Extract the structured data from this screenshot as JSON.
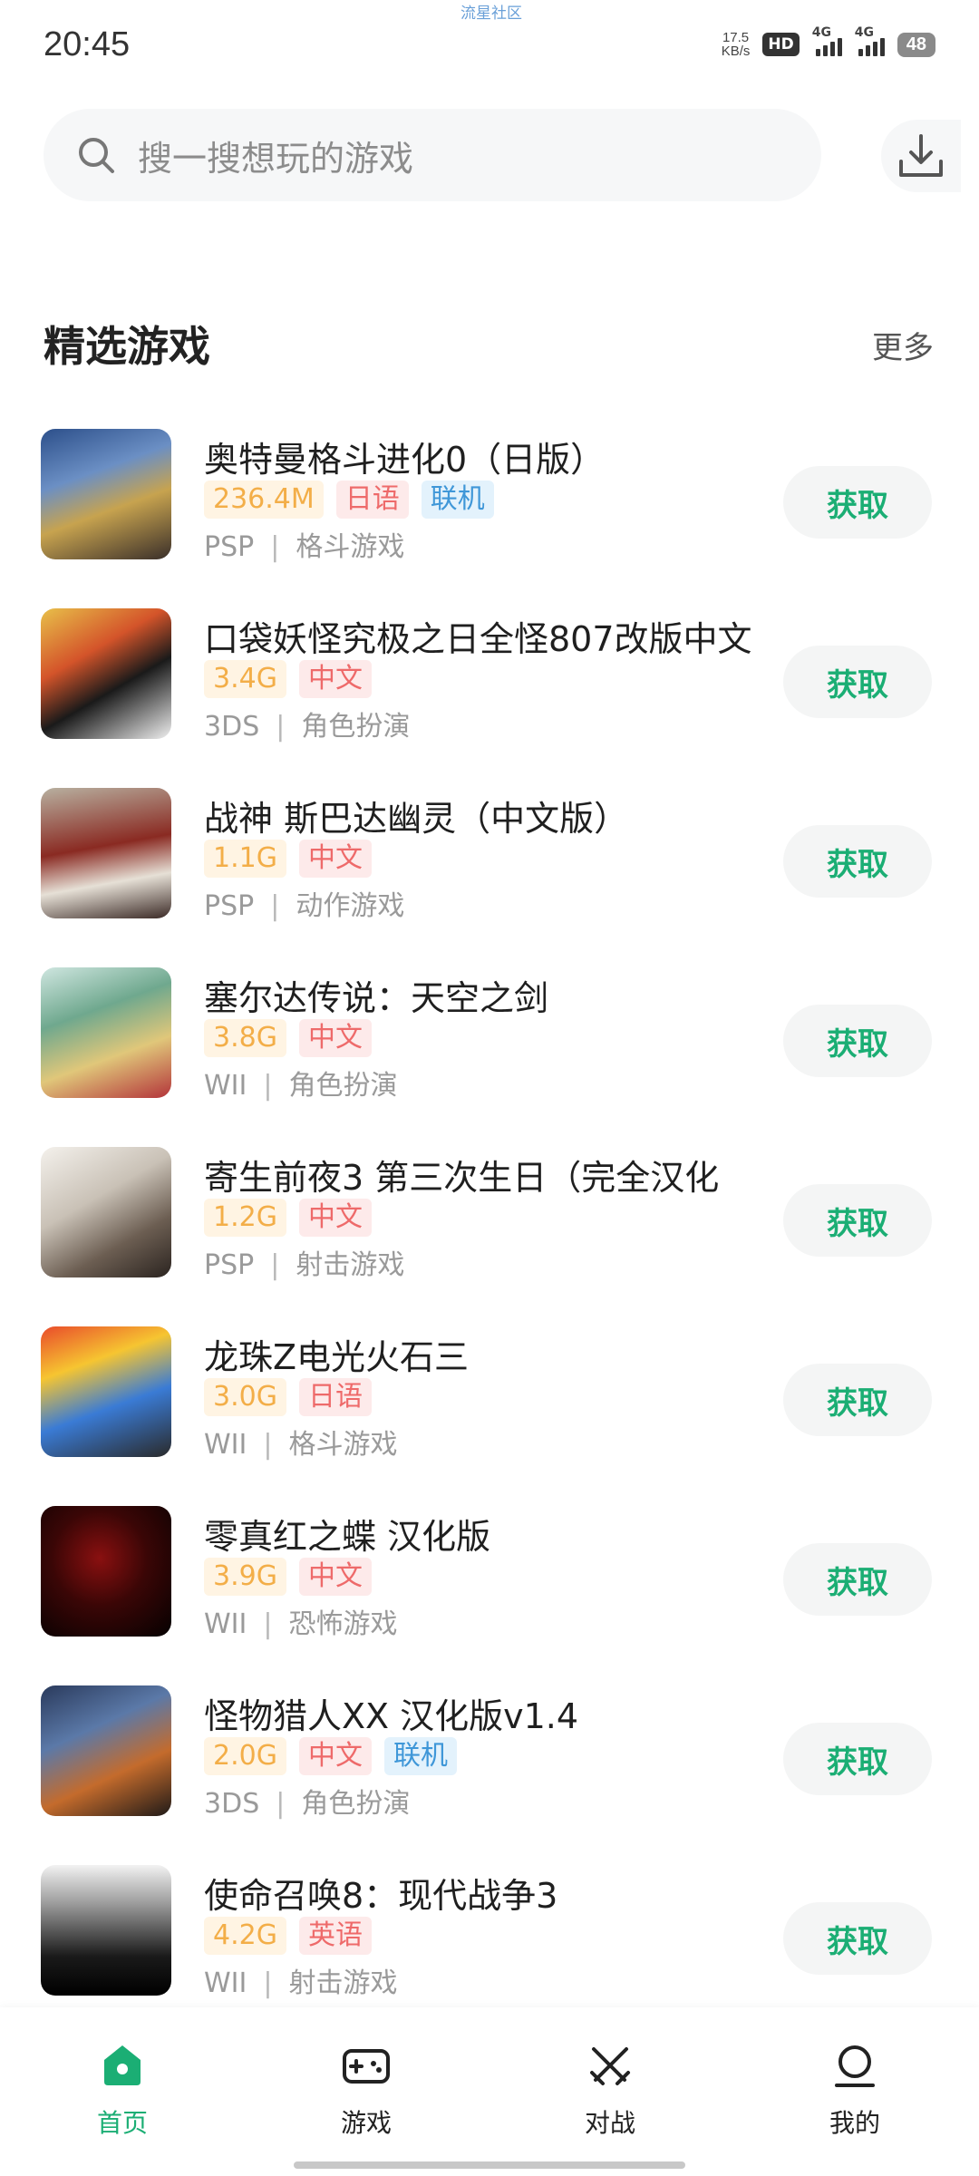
{
  "status_bar": {
    "time": "20:45",
    "center_text": "流星社区",
    "net_speed_value": "17.5",
    "net_speed_unit": "KB/s",
    "hd_label": "HD",
    "signal_label": "4G",
    "battery": "48"
  },
  "search": {
    "placeholder": "搜一搜想玩的游戏"
  },
  "section": {
    "title": "精选游戏",
    "more": "更多"
  },
  "games": [
    {
      "name": "奥特曼格斗进化0（日版）",
      "size": "236.4M",
      "lang": "日语",
      "online": "联机",
      "platform": "PSP",
      "genre": "格斗游戏",
      "button": "获取"
    },
    {
      "name": "口袋妖怪究极之日全怪807改版中文",
      "size": "3.4G",
      "lang": "中文",
      "platform": "3DS",
      "genre": "角色扮演",
      "button": "获取"
    },
    {
      "name": "战神 斯巴达幽灵（中文版）",
      "size": "1.1G",
      "lang": "中文",
      "platform": "PSP",
      "genre": "动作游戏",
      "button": "获取"
    },
    {
      "name": "塞尔达传说：天空之剑",
      "size": "3.8G",
      "lang": "中文",
      "platform": "WII",
      "genre": "角色扮演",
      "button": "获取"
    },
    {
      "name": "寄生前夜3 第三次生日（完全汉化",
      "size": "1.2G",
      "lang": "中文",
      "platform": "PSP",
      "genre": "射击游戏",
      "button": "获取"
    },
    {
      "name": "龙珠Z电光火石三",
      "size": "3.0G",
      "lang": "日语",
      "platform": "WII",
      "genre": "格斗游戏",
      "button": "获取"
    },
    {
      "name": "零真红之蝶 汉化版",
      "size": "3.9G",
      "lang": "中文",
      "platform": "WII",
      "genre": "恐怖游戏",
      "button": "获取"
    },
    {
      "name": "怪物猎人XX 汉化版v1.4",
      "size": "2.0G",
      "lang": "中文",
      "online": "联机",
      "platform": "3DS",
      "genre": "角色扮演",
      "button": "获取"
    },
    {
      "name": "使命召唤8：现代战争3",
      "size": "4.2G",
      "lang": "英语",
      "platform": "WII",
      "genre": "射击游戏",
      "button": "获取"
    }
  ],
  "nav": {
    "home": "首页",
    "games": "游戏",
    "battle": "对战",
    "mine": "我的"
  },
  "colors": {
    "accent": "#1bae74",
    "size_tag": "#f3ae48",
    "lang_tag": "#ee6a6a",
    "online_tag": "#3f97d8"
  }
}
